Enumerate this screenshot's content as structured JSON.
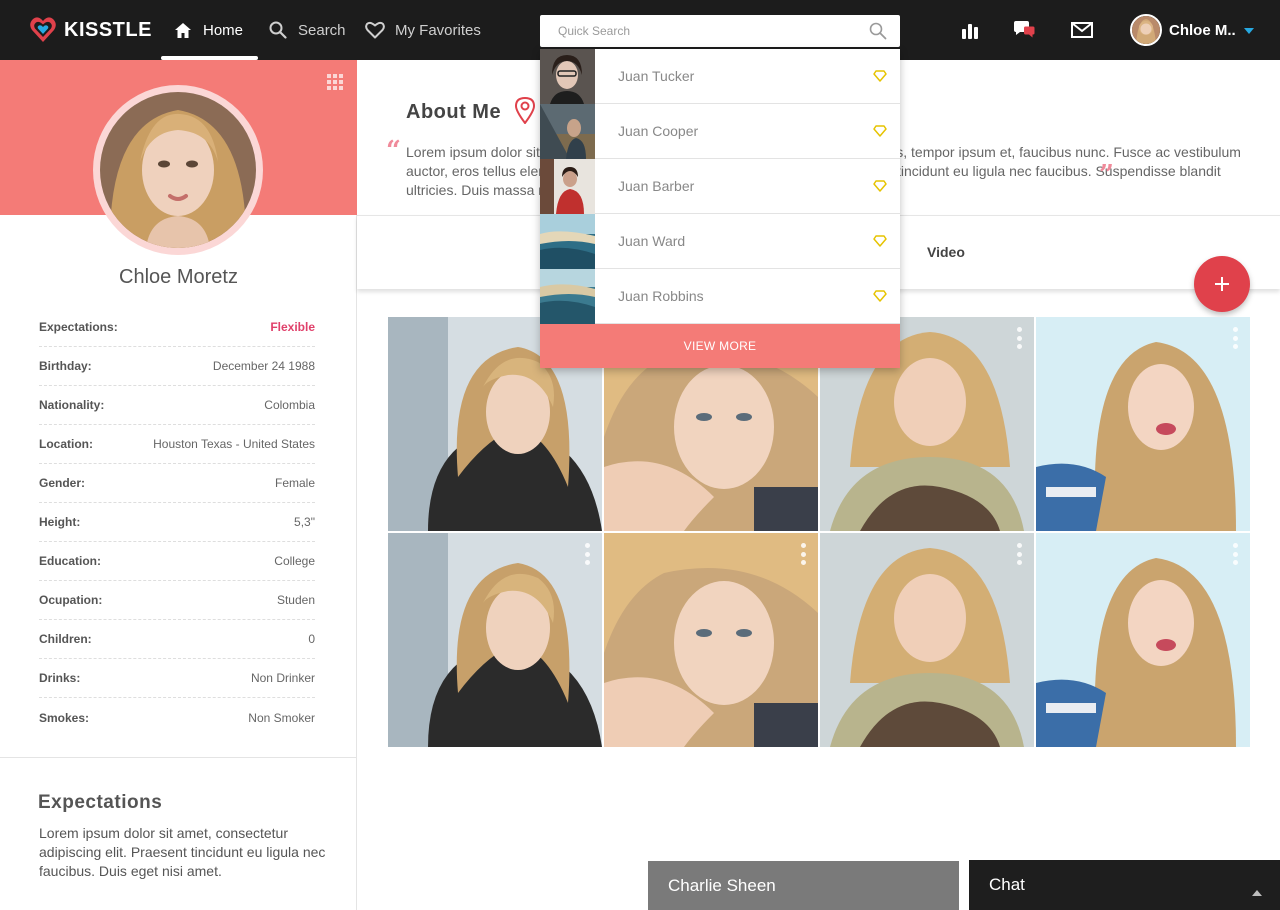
{
  "brand": {
    "name": "KISSTLE",
    "accent": "#f47b77",
    "dark": "#1c1c1c",
    "icon": "heart-logo-icon"
  },
  "nav": {
    "items": [
      {
        "label": "Home",
        "icon": "home-icon",
        "active": true
      },
      {
        "label": "Search",
        "icon": "search-icon",
        "active": false
      },
      {
        "label": "My Favorites",
        "icon": "heart-icon",
        "active": false
      }
    ]
  },
  "quick_search": {
    "placeholder": "Quick Search",
    "icon": "search-icon"
  },
  "top_icons": [
    "stats-icon",
    "chat-bubbles-icon",
    "mail-icon"
  ],
  "user": {
    "name": "Chloe M..",
    "caret_color": "#27a9e1"
  },
  "profile": {
    "name": "Chloe Moretz",
    "details": [
      {
        "label": "Expectations:",
        "value": "Flexible",
        "accent": true
      },
      {
        "label": "Birthday:",
        "value": "December 24 1988"
      },
      {
        "label": "Nationality:",
        "value": "Colombia"
      },
      {
        "label": "Location:",
        "value": "Houston Texas - United States"
      },
      {
        "label": "Gender:",
        "value": "Female"
      },
      {
        "label": "Height:",
        "value": "5,3\""
      },
      {
        "label": "Education:",
        "value": "College"
      },
      {
        "label": "Ocupation:",
        "value": "Studen"
      },
      {
        "label": "Children:",
        "value": "0"
      },
      {
        "label": "Drinks:",
        "value": "Non Drinker"
      },
      {
        "label": "Smokes:",
        "value": "Non Smoker"
      }
    ]
  },
  "expectations": {
    "title": "Expectations",
    "text": "Lorem ipsum dolor sit amet, consectetur adipiscing elit. Praesent tincidunt eu ligula nec faucibus. Duis eget nisi amet."
  },
  "about": {
    "title": "About Me",
    "text": "Lorem ipsum dolor sit amet, consectetur adipiscing elit. Aliquam ac nunc tempus, tempor ipsum et, faucibus nunc. Fusce ac vestibulum auctor, eros tellus elementum lorem, ac dignissim leo libero eget nisi. Praesent tincidunt eu ligula nec faucibus. Suspendisse blandit ultricies. Duis massa nunc."
  },
  "tabs": [
    {
      "label": "Video"
    }
  ],
  "fab": {
    "label": "+"
  },
  "search_results": [
    {
      "name": "Juan Tucker"
    },
    {
      "name": "Juan Cooper"
    },
    {
      "name": "Juan Barber"
    },
    {
      "name": "Juan Ward"
    },
    {
      "name": "Juan Robbins"
    }
  ],
  "view_more_label": "VIEW MORE",
  "chat": {
    "open_user": "Charlie Sheen",
    "title": "Chat"
  }
}
